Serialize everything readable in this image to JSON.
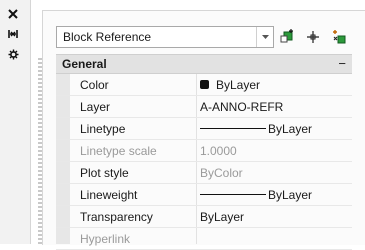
{
  "dropdown": {
    "value": "Block Reference"
  },
  "toolbar": {
    "quick_select_icon": "quick-select-icon",
    "select_objects_icon": "select-objects-icon",
    "toggle_pickadd_icon": "toggle-pickadd-icon"
  },
  "section": {
    "title": "General",
    "collapse_glyph": "−"
  },
  "properties": [
    {
      "name": "Color",
      "value": "ByLayer"
    },
    {
      "name": "Layer",
      "value": "A-ANNO-REFR"
    },
    {
      "name": "Linetype",
      "value": "ByLayer"
    },
    {
      "name": "Linetype scale",
      "value": "1.0000"
    },
    {
      "name": "Plot style",
      "value": "ByColor"
    },
    {
      "name": "Lineweight",
      "value": "ByLayer"
    },
    {
      "name": "Transparency",
      "value": "ByLayer"
    },
    {
      "name": "Hyperlink",
      "value": ""
    }
  ],
  "left_strip": {
    "close_icon": "close-icon",
    "auto_hide_icon": "auto-hide-icon",
    "properties_icon": "properties-gear-icon"
  }
}
